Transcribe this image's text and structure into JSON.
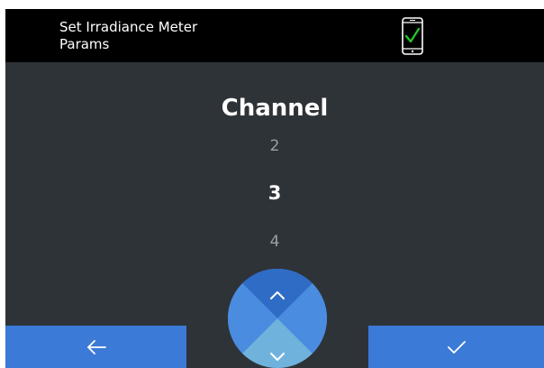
{
  "header": {
    "title": "Set Irradiance Meter\nParams",
    "icon": "phone-connected-icon",
    "icon_check_color": "#27c42a"
  },
  "picker": {
    "title": "Channel",
    "previous_value": "2",
    "current_value": "3",
    "next_value": "4"
  },
  "controls": {
    "back_icon": "arrow-left-icon",
    "confirm_icon": "check-icon",
    "up_icon": "chevron-up-icon",
    "down_icon": "chevron-down-icon"
  },
  "colors": {
    "background": "#2e3338",
    "header": "#000000",
    "accent": "#3b7ad6",
    "dial_up": "#2f6cc6",
    "dial_down": "#6fb3dc"
  }
}
